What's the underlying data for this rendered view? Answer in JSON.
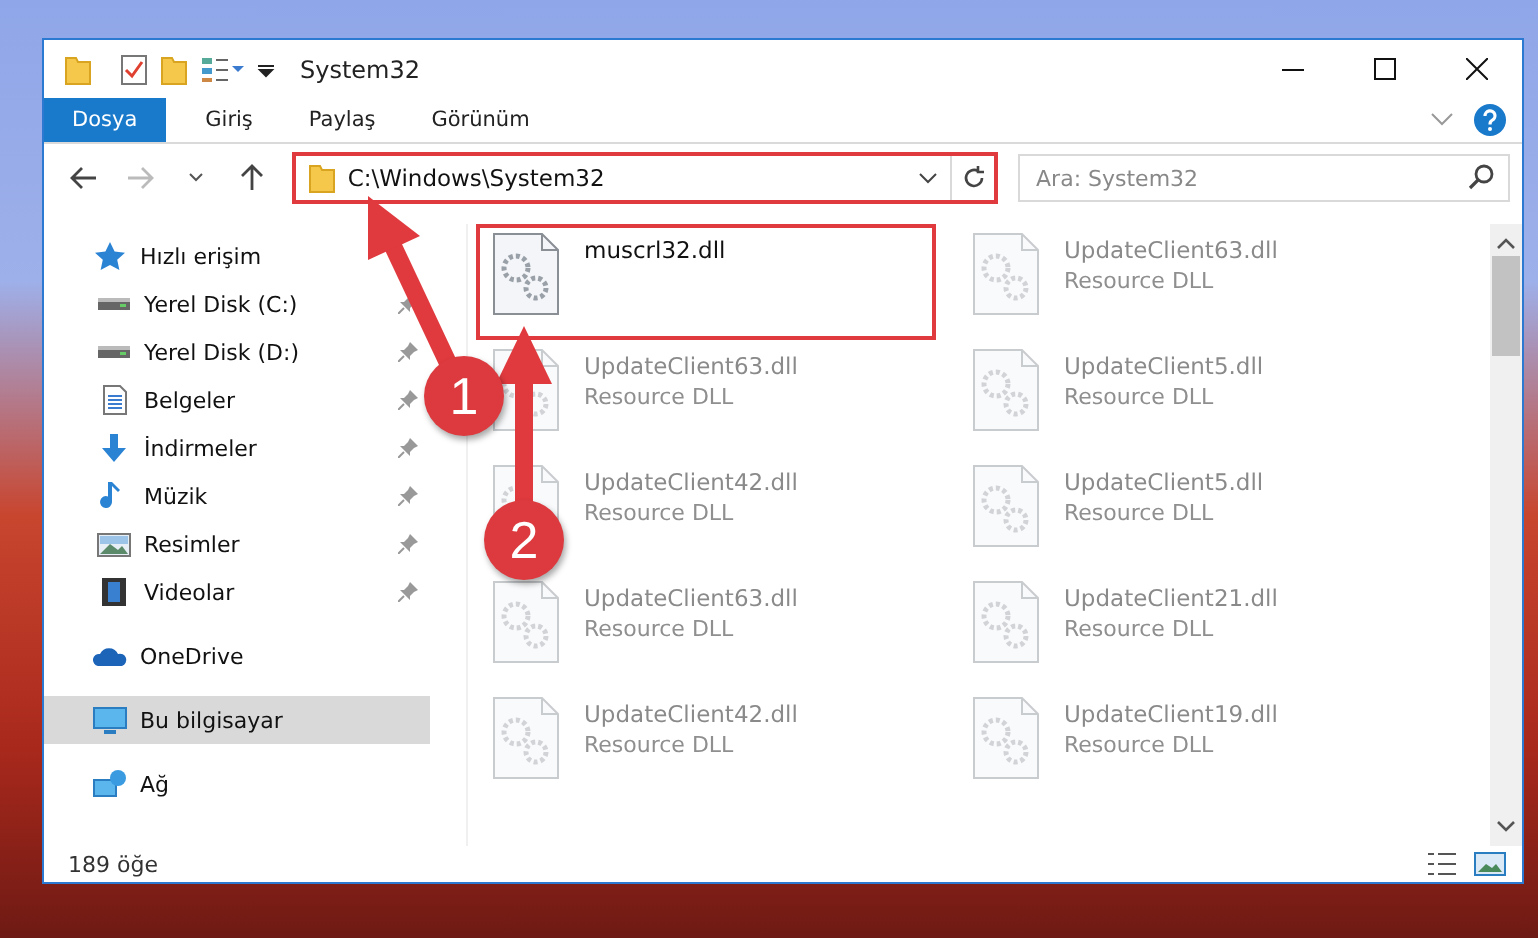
{
  "window": {
    "title": "System32"
  },
  "ribbon_tabs": [
    {
      "label": "Dosya",
      "selected": true
    },
    {
      "label": "Giriş",
      "selected": false
    },
    {
      "label": "Paylaş",
      "selected": false
    },
    {
      "label": "Görünüm",
      "selected": false
    }
  ],
  "address": {
    "path": "C:\\Windows\\System32",
    "highlighted": true
  },
  "search": {
    "placeholder": "Ara: System32"
  },
  "sidebar": {
    "items": [
      {
        "label": "Hızlı erişim",
        "kind": "star",
        "selected": false,
        "children": [
          {
            "label": "Yerel Disk (C:)",
            "kind": "drive",
            "pinned": true,
            "selected": false
          },
          {
            "label": "Yerel Disk (D:)",
            "kind": "drive",
            "pinned": true,
            "selected": false
          },
          {
            "label": "Belgeler",
            "kind": "document",
            "pinned": true,
            "selected": false
          },
          {
            "label": "İndirmeler",
            "kind": "download",
            "pinned": true,
            "selected": false
          },
          {
            "label": "Müzik",
            "kind": "music",
            "pinned": true,
            "selected": false
          },
          {
            "label": "Resimler",
            "kind": "picture",
            "pinned": true,
            "selected": false
          },
          {
            "label": "Videolar",
            "kind": "video",
            "pinned": true,
            "selected": false
          }
        ]
      },
      {
        "label": "OneDrive",
        "kind": "cloud",
        "selected": false
      },
      {
        "label": "Bu bilgisayar",
        "kind": "computer",
        "selected": true
      },
      {
        "label": "Ağ",
        "kind": "network",
        "selected": false
      }
    ]
  },
  "files": [
    {
      "name": "muscrl32.dll",
      "highlighted": true,
      "faded": false
    },
    {
      "name": "UpdateClient63.dll",
      "type": "Resource DLL",
      "highlighted": false,
      "faded": true
    },
    {
      "name": "UpdateClient63.dll",
      "type": "Resource DLL",
      "highlighted": false,
      "faded": true
    },
    {
      "name": "UpdateClient5.dll",
      "type": "Resource DLL",
      "highlighted": false,
      "faded": true
    },
    {
      "name": "UpdateClient42.dll",
      "type": "Resource DLL",
      "highlighted": false,
      "faded": true
    },
    {
      "name": "UpdateClient5.dll",
      "type": "Resource DLL",
      "highlighted": false,
      "faded": true
    },
    {
      "name": "UpdateClient63.dll",
      "type": "Resource DLL",
      "highlighted": false,
      "faded": true
    },
    {
      "name": "UpdateClient21.dll",
      "type": "Resource DLL",
      "highlighted": false,
      "faded": true
    },
    {
      "name": "UpdateClient42.dll",
      "type": "Resource DLL",
      "highlighted": false,
      "faded": true
    },
    {
      "name": "UpdateClient19.dll",
      "type": "Resource DLL",
      "highlighted": false,
      "faded": true
    }
  ],
  "status_bar": {
    "count": "189 öğe"
  },
  "annotations": [
    {
      "label": "1"
    },
    {
      "label": "2"
    }
  ]
}
